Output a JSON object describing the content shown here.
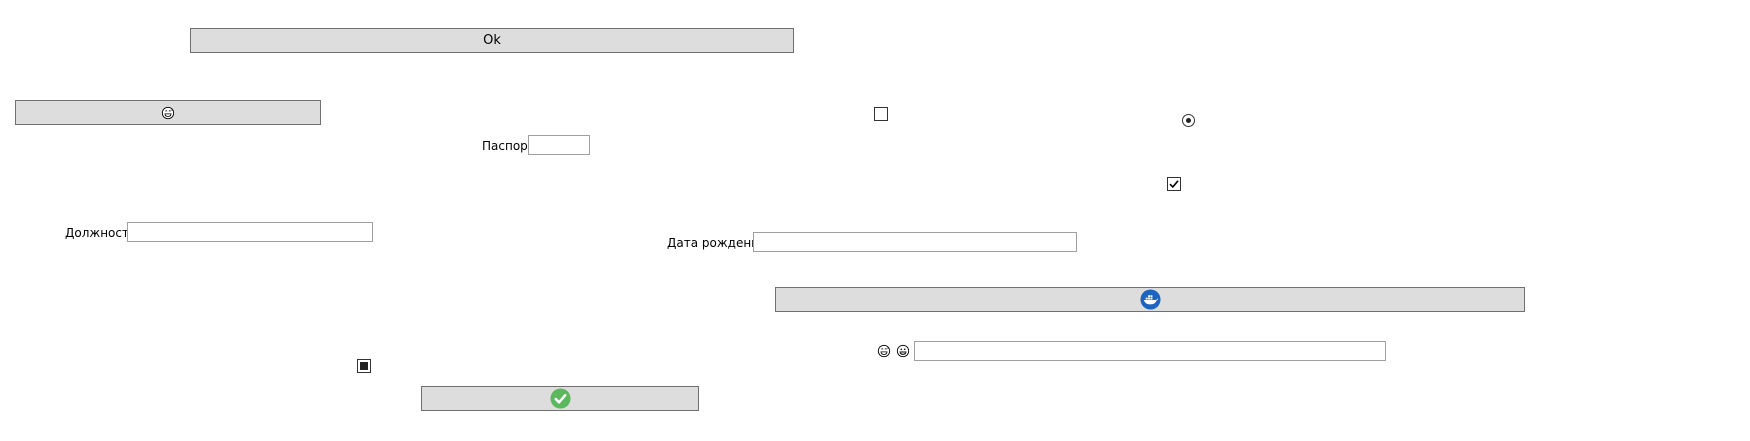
{
  "buttons": {
    "ok_label": "Ok"
  },
  "labels": {
    "passport": "Паспорт",
    "position": "Должность",
    "birth_date": "Дата рождения"
  },
  "fields": {
    "passport_value": "",
    "position_value": "",
    "birth_date_value": "",
    "emoji_field_value": ""
  },
  "checkboxes": {
    "top_checkbox_checked": false,
    "middle_checkbox_checked": true,
    "bottom_checkbox_state": "indeterminate"
  },
  "radio": {
    "selected": true
  },
  "icons": {
    "emoji_button_icon": "grinning-sweat-face-icon",
    "docker_button_icon": "docker-whale-icon",
    "check_button_icon": "green-check-circle-icon",
    "emoji_label_icons": [
      "grinning-sweat-face-icon",
      "grinning-face-icon"
    ]
  },
  "colors": {
    "button_bg": "#dddddd",
    "docker_blue": "#1d63c0",
    "check_green": "#5cb85c"
  }
}
